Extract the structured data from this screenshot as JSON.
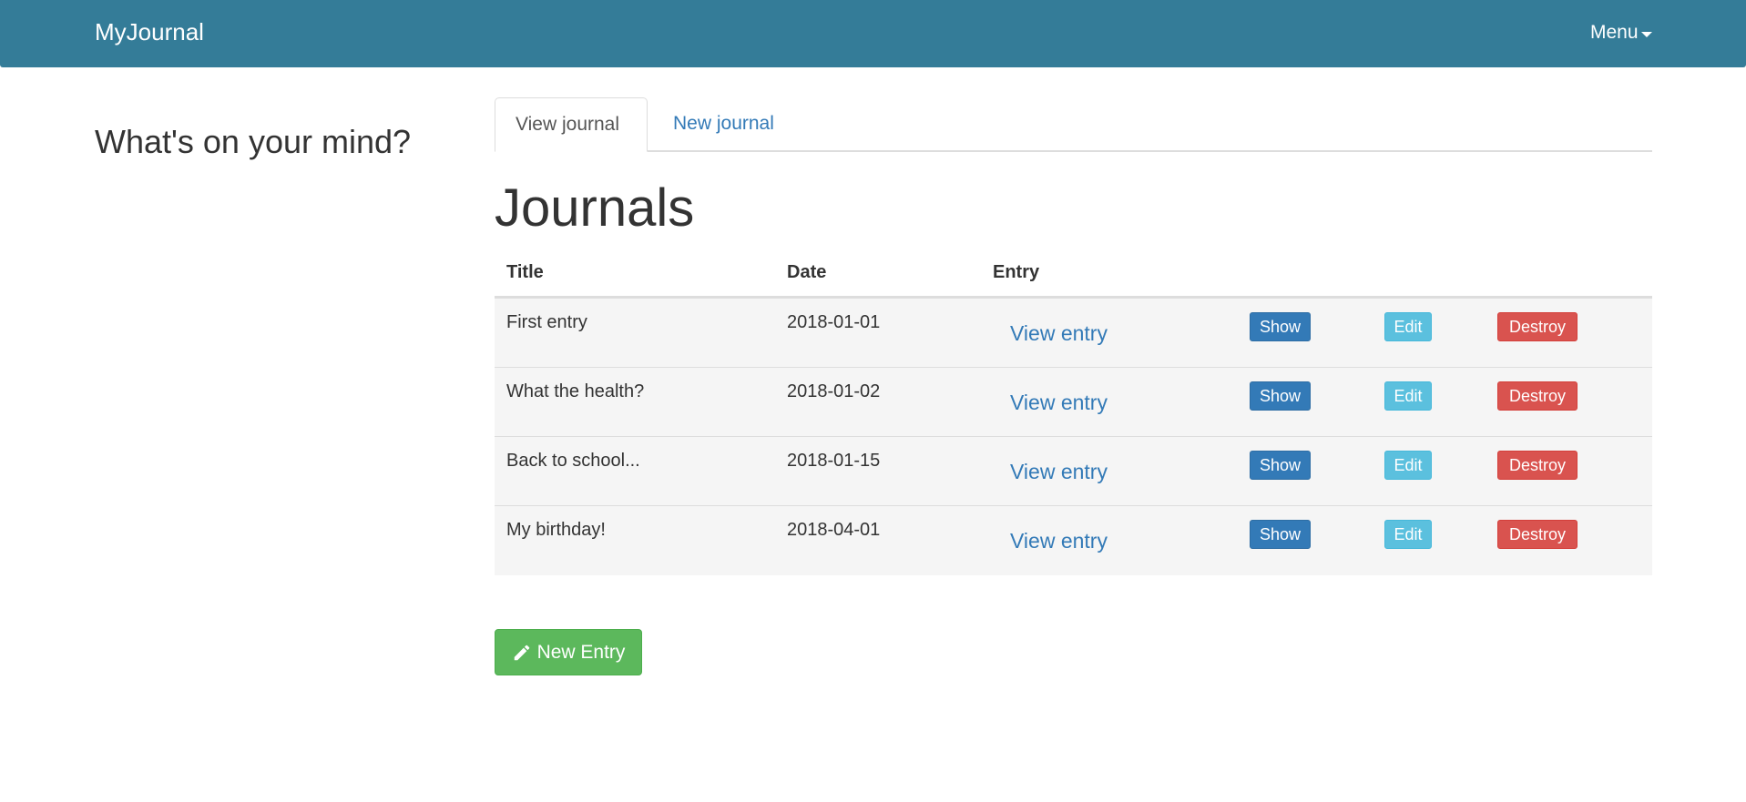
{
  "navbar": {
    "brand": "MyJournal",
    "menu_label": "Menu",
    "background_color": "#347c98"
  },
  "sidebar": {
    "heading": "What's on your mind?"
  },
  "tabs": [
    {
      "label": "View journal",
      "active": true
    },
    {
      "label": "New journal",
      "active": false
    }
  ],
  "main": {
    "title": "Journals",
    "columns": {
      "title": "Title",
      "date": "Date",
      "entry": "Entry"
    },
    "rows": [
      {
        "title": "First entry",
        "date": "2018-01-01",
        "entry_link": "View entry",
        "show": "Show",
        "edit": "Edit",
        "destroy": "Destroy"
      },
      {
        "title": "What the health?",
        "date": "2018-01-02",
        "entry_link": "View entry",
        "show": "Show",
        "edit": "Edit",
        "destroy": "Destroy"
      },
      {
        "title": "Back to school...",
        "date": "2018-01-15",
        "entry_link": "View entry",
        "show": "Show",
        "edit": "Edit",
        "destroy": "Destroy"
      },
      {
        "title": "My birthday!",
        "date": "2018-04-01",
        "entry_link": "View entry",
        "show": "Show",
        "edit": "Edit",
        "destroy": "Destroy"
      }
    ],
    "new_entry_button": {
      "label": "New Entry",
      "icon": "pencil-icon"
    }
  },
  "colors": {
    "primary": "#337ab7",
    "info": "#5bc0de",
    "danger": "#d9534f",
    "success": "#5cb85c"
  }
}
